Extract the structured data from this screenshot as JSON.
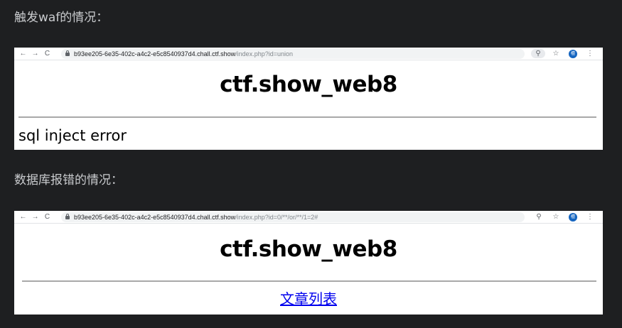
{
  "captions": {
    "first": "触发waf的情况：",
    "second": "数据库报错的情况："
  },
  "screenshot1": {
    "nav": {
      "back": "←",
      "forward": "→",
      "reload": "C"
    },
    "url_host": "b93ee205-6e35-402c-a4c2-e5c8540937d4.chall.ctf.show",
    "url_path": "/index.php?id=union",
    "title": "ctf.show_web8",
    "message": "sql inject error",
    "avatar_letter": "檀"
  },
  "screenshot2": {
    "nav": {
      "back": "←",
      "forward": "→",
      "reload": "C"
    },
    "url_host": "b93ee205-6e35-402c-a4c2-e5c8540937d4.chall.ctf.show",
    "url_path": "/index.php?id=0/**/or/**/1=2#",
    "title": "ctf.show_web8",
    "link": "文章列表",
    "avatar_letter": "檀"
  },
  "icons": {
    "zoom": "⚲",
    "star": "☆",
    "menu": "⋮"
  },
  "colors": {
    "background": "#1e1f21",
    "caption": "#c9cbce",
    "link": "#0000ee",
    "avatar": "#1565c0"
  }
}
